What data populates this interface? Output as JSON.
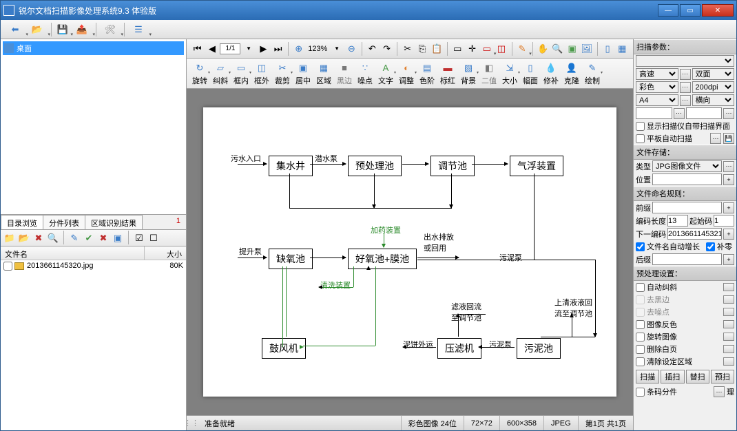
{
  "title": "锐尔文档扫描影像处理系统9.3 体验版",
  "tree": {
    "root": "桌面"
  },
  "tabs": [
    "目录浏览",
    "分件列表",
    "区域识别结果"
  ],
  "tab_count": "1",
  "file_header": {
    "name": "文件名",
    "size": "大小"
  },
  "files": [
    {
      "name": "2013661145320.jpg",
      "size": "80K"
    }
  ],
  "doc_toolbar": {
    "page": "1/1",
    "zoom": "123%"
  },
  "ribbon": [
    {
      "label": "旋转",
      "icon": "↻",
      "cls": "ic-blue",
      "dd": true
    },
    {
      "label": "纠斜",
      "icon": "▱",
      "cls": "ic-blue",
      "dd": true
    },
    {
      "label": "框内",
      "icon": "▭",
      "cls": "ic-blue",
      "dd": true
    },
    {
      "label": "框外",
      "icon": "◫",
      "cls": "ic-blue"
    },
    {
      "label": "裁剪",
      "icon": "✂",
      "cls": "ic-blue",
      "dd": true
    },
    {
      "label": "居中",
      "icon": "▣",
      "cls": "ic-blue"
    },
    {
      "label": "区域",
      "icon": "▦",
      "cls": "ic-blue"
    },
    {
      "label": "黑边",
      "icon": "■",
      "cls": "",
      "disabled": true
    },
    {
      "label": "噪点",
      "icon": "∵",
      "cls": "ic-blue"
    },
    {
      "label": "文字",
      "icon": "A",
      "cls": "ic-green",
      "dd": true
    },
    {
      "label": "调整",
      "icon": "◐",
      "cls": "ic-orange",
      "dd": true
    },
    {
      "label": "色阶",
      "icon": "▤",
      "cls": "ic-blue"
    },
    {
      "label": "标红",
      "icon": "▬",
      "cls": "ic-red"
    },
    {
      "label": "背景",
      "icon": "▧",
      "cls": "ic-blue",
      "dd": true
    },
    {
      "label": "二值",
      "icon": "◧",
      "cls": "",
      "disabled": true
    },
    {
      "label": "大小",
      "icon": "⇲",
      "cls": "ic-blue",
      "dd": true
    },
    {
      "label": "幅面",
      "icon": "▯",
      "cls": "ic-blue"
    },
    {
      "label": "修补",
      "icon": "💧",
      "cls": "ic-blue"
    },
    {
      "label": "克隆",
      "icon": "👤",
      "cls": "ic-orange"
    },
    {
      "label": "绘制",
      "icon": "✎",
      "cls": "ic-blue",
      "dd": true
    }
  ],
  "statusbar": {
    "ready": "准备就绪",
    "color": "彩色图像 24位",
    "coord": "72×72",
    "size": "600×358",
    "format": "JPEG",
    "page": "第1页 共1页"
  },
  "right": {
    "scan_params": "扫描参数：",
    "speed": "高速",
    "duplex": "双面",
    "color": "彩色",
    "dpi": "200dpi",
    "paper": "A4",
    "orient": "横向",
    "show_ui": "显示扫描仪自带扫描界面",
    "flatbed": "平板自动扫描",
    "file_save": "文件存储：",
    "type_lbl": "类型",
    "type_val": "JPG图像文件",
    "loc_lbl": "位置",
    "naming": "文件命名规则：",
    "prefix_lbl": "前缀",
    "codelen_lbl": "编码长度",
    "codelen_val": "13",
    "startcode_lbl": "起始码",
    "startcode_val": "1",
    "nextcode_lbl": "下一编码",
    "nextcode_val": "2013661145321",
    "autogrow": "文件名自动增长",
    "pad": "补零",
    "suffix_lbl": "后缀",
    "preproc": "预处理设置：",
    "pp": [
      "自动纠斜",
      "去黑边",
      "去噪点",
      "图像反色",
      "旋转图像",
      "删除白页",
      "清除设定区域"
    ],
    "btns": [
      "扫描",
      "插扫",
      "替扫",
      "预扫"
    ],
    "barcode": "条码分件",
    "li": "理"
  },
  "diagram": {
    "boxes": {
      "b1": "集水井",
      "b2": "预处理池",
      "b3": "调节池",
      "b4": "气浮装置",
      "b5": "缺氧池",
      "b6": "好氧池+膜池",
      "b7": "鼓风机",
      "b8": "压滤机",
      "b9": "污泥池"
    },
    "labels": {
      "l1": "污水入口",
      "l2": "潜水泵",
      "l3": "加药装置",
      "l4": "出水排放\n或回用",
      "l5": "提升泵",
      "l6": "污泥泵",
      "l7": "清洗装置",
      "l8": "滤液回流\n至调节池",
      "l9": "上清液液回\n流至调节池",
      "l10": "泥饼外运",
      "l11": "污泥泵"
    }
  }
}
